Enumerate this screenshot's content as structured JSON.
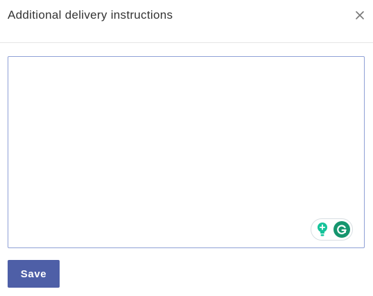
{
  "dialog": {
    "title": "Additional delivery instructions",
    "close_icon": "close-icon"
  },
  "instructions_field": {
    "value": "",
    "placeholder": ""
  },
  "grammarly": {
    "suggestion_icon": "lightbulb-icon",
    "logo_icon": "grammarly-g-icon",
    "accent_color": "#15956e"
  },
  "footer": {
    "save_label": "Save",
    "save_color": "#4e5fa7"
  }
}
